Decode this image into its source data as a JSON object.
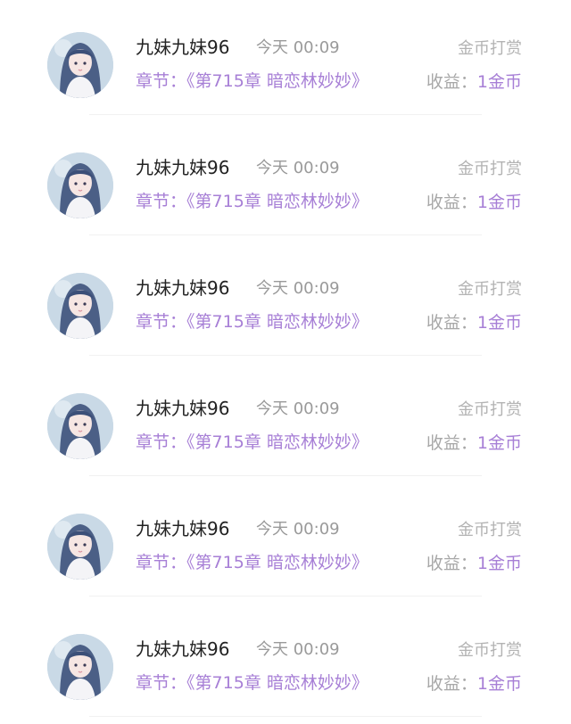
{
  "colors": {
    "name": "#222222",
    "time": "#9a9a9a",
    "type_label": "#b3b3b3",
    "accent_purple": "#a77fd6",
    "income_label": "#a7a7a7",
    "avatar_bg": "#c9d9e6"
  },
  "records": [
    {
      "avatar_icon": "anime-girl-avatar-icon",
      "name": "九妹九妹96",
      "time": "今天 00:09",
      "type": "金币打赏",
      "chapter_label": "章节：",
      "chapter_title": "《第715章 暗恋林妙妙》",
      "income_label": "收益：",
      "income_value": "1金币"
    },
    {
      "avatar_icon": "anime-girl-avatar-icon",
      "name": "九妹九妹96",
      "time": "今天 00:09",
      "type": "金币打赏",
      "chapter_label": "章节：",
      "chapter_title": "《第715章 暗恋林妙妙》",
      "income_label": "收益：",
      "income_value": "1金币"
    },
    {
      "avatar_icon": "anime-girl-avatar-icon",
      "name": "九妹九妹96",
      "time": "今天 00:09",
      "type": "金币打赏",
      "chapter_label": "章节：",
      "chapter_title": "《第715章 暗恋林妙妙》",
      "income_label": "收益：",
      "income_value": "1金币"
    },
    {
      "avatar_icon": "anime-girl-avatar-icon",
      "name": "九妹九妹96",
      "time": "今天 00:09",
      "type": "金币打赏",
      "chapter_label": "章节：",
      "chapter_title": "《第715章 暗恋林妙妙》",
      "income_label": "收益：",
      "income_value": "1金币"
    },
    {
      "avatar_icon": "anime-girl-avatar-icon",
      "name": "九妹九妹96",
      "time": "今天 00:09",
      "type": "金币打赏",
      "chapter_label": "章节：",
      "chapter_title": "《第715章 暗恋林妙妙》",
      "income_label": "收益：",
      "income_value": "1金币"
    },
    {
      "avatar_icon": "anime-girl-avatar-icon",
      "name": "九妹九妹96",
      "time": "今天 00:09",
      "type": "金币打赏",
      "chapter_label": "章节：",
      "chapter_title": "《第715章 暗恋林妙妙》",
      "income_label": "收益：",
      "income_value": "1金币"
    }
  ]
}
